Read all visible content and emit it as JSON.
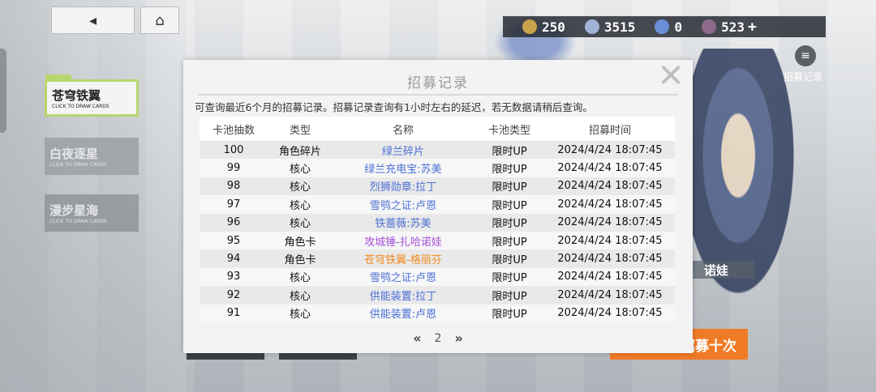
{
  "resources": [
    {
      "icon": "coin-icon",
      "value": "250",
      "color": "#c9a24a"
    },
    {
      "icon": "crystal-icon",
      "value": "3515",
      "color": "#9fb3d8"
    },
    {
      "icon": "ticket-icon",
      "value": "0",
      "color": "#6b8fd6"
    },
    {
      "icon": "emblem-icon",
      "value": "523",
      "color": "#8e6b8a"
    }
  ],
  "nav": {
    "back_icon": "◂",
    "home_icon": "⌂"
  },
  "record_button_label": "招募记录",
  "banners": [
    {
      "tag": "",
      "title": "苍穹铁翼",
      "sub": "CLICK TO DRAW CARDS"
    },
    {
      "title": "白夜逐星",
      "sub": "CLICK TO DRAW CARDS"
    },
    {
      "title": "漫步星海",
      "sub": "CLICK TO DRAW CARDS"
    }
  ],
  "side_name": "诺娃",
  "draw_ten_label": "招募十次",
  "dialog": {
    "title": "招募记录",
    "close": "✕",
    "notice": "可查询最近6个月的招募记录。招募记录查询有1小时左右的延迟，若无数据请稍后查询。",
    "columns": [
      "卡池抽数",
      "类型",
      "名称",
      "卡池类型",
      "招募时间"
    ],
    "rows": [
      {
        "count": "100",
        "type": "角色碎片",
        "name": "绿兰碎片",
        "pool": "限时UP",
        "time": "2024/4/24 18:07:45",
        "color": "#4a6fd4"
      },
      {
        "count": "99",
        "type": "核心",
        "name": "绿兰充电宝:苏美",
        "pool": "限时UP",
        "time": "2024/4/24 18:07:45",
        "color": "#4a6fd4"
      },
      {
        "count": "98",
        "type": "核心",
        "name": "烈狮勋章:拉丁",
        "pool": "限时UP",
        "time": "2024/4/24 18:07:45",
        "color": "#4a6fd4"
      },
      {
        "count": "97",
        "type": "核心",
        "name": "雪鸮之证:卢恩",
        "pool": "限时UP",
        "time": "2024/4/24 18:07:45",
        "color": "#4a6fd4"
      },
      {
        "count": "96",
        "type": "核心",
        "name": "铁蔷薇:苏美",
        "pool": "限时UP",
        "time": "2024/4/24 18:07:45",
        "color": "#4a6fd4"
      },
      {
        "count": "95",
        "type": "角色卡",
        "name": "攻城锤-扎哈诺娃",
        "pool": "限时UP",
        "time": "2024/4/24 18:07:45",
        "color": "#a24fd6"
      },
      {
        "count": "94",
        "type": "角色卡",
        "name": "苍穹铁翼-格丽芬",
        "pool": "限时UP",
        "time": "2024/4/24 18:07:45",
        "color": "#f08a1e"
      },
      {
        "count": "93",
        "type": "核心",
        "name": "雪鸮之证:卢恩",
        "pool": "限时UP",
        "time": "2024/4/24 18:07:45",
        "color": "#4a6fd4"
      },
      {
        "count": "92",
        "type": "核心",
        "name": "供能装置:拉丁",
        "pool": "限时UP",
        "time": "2024/4/24 18:07:45",
        "color": "#4a6fd4"
      },
      {
        "count": "91",
        "type": "核心",
        "name": "供能装置:卢恩",
        "pool": "限时UP",
        "time": "2024/4/24 18:07:45",
        "color": "#4a6fd4"
      }
    ],
    "pager": {
      "prev": "«",
      "page": "2",
      "next": "»"
    }
  }
}
